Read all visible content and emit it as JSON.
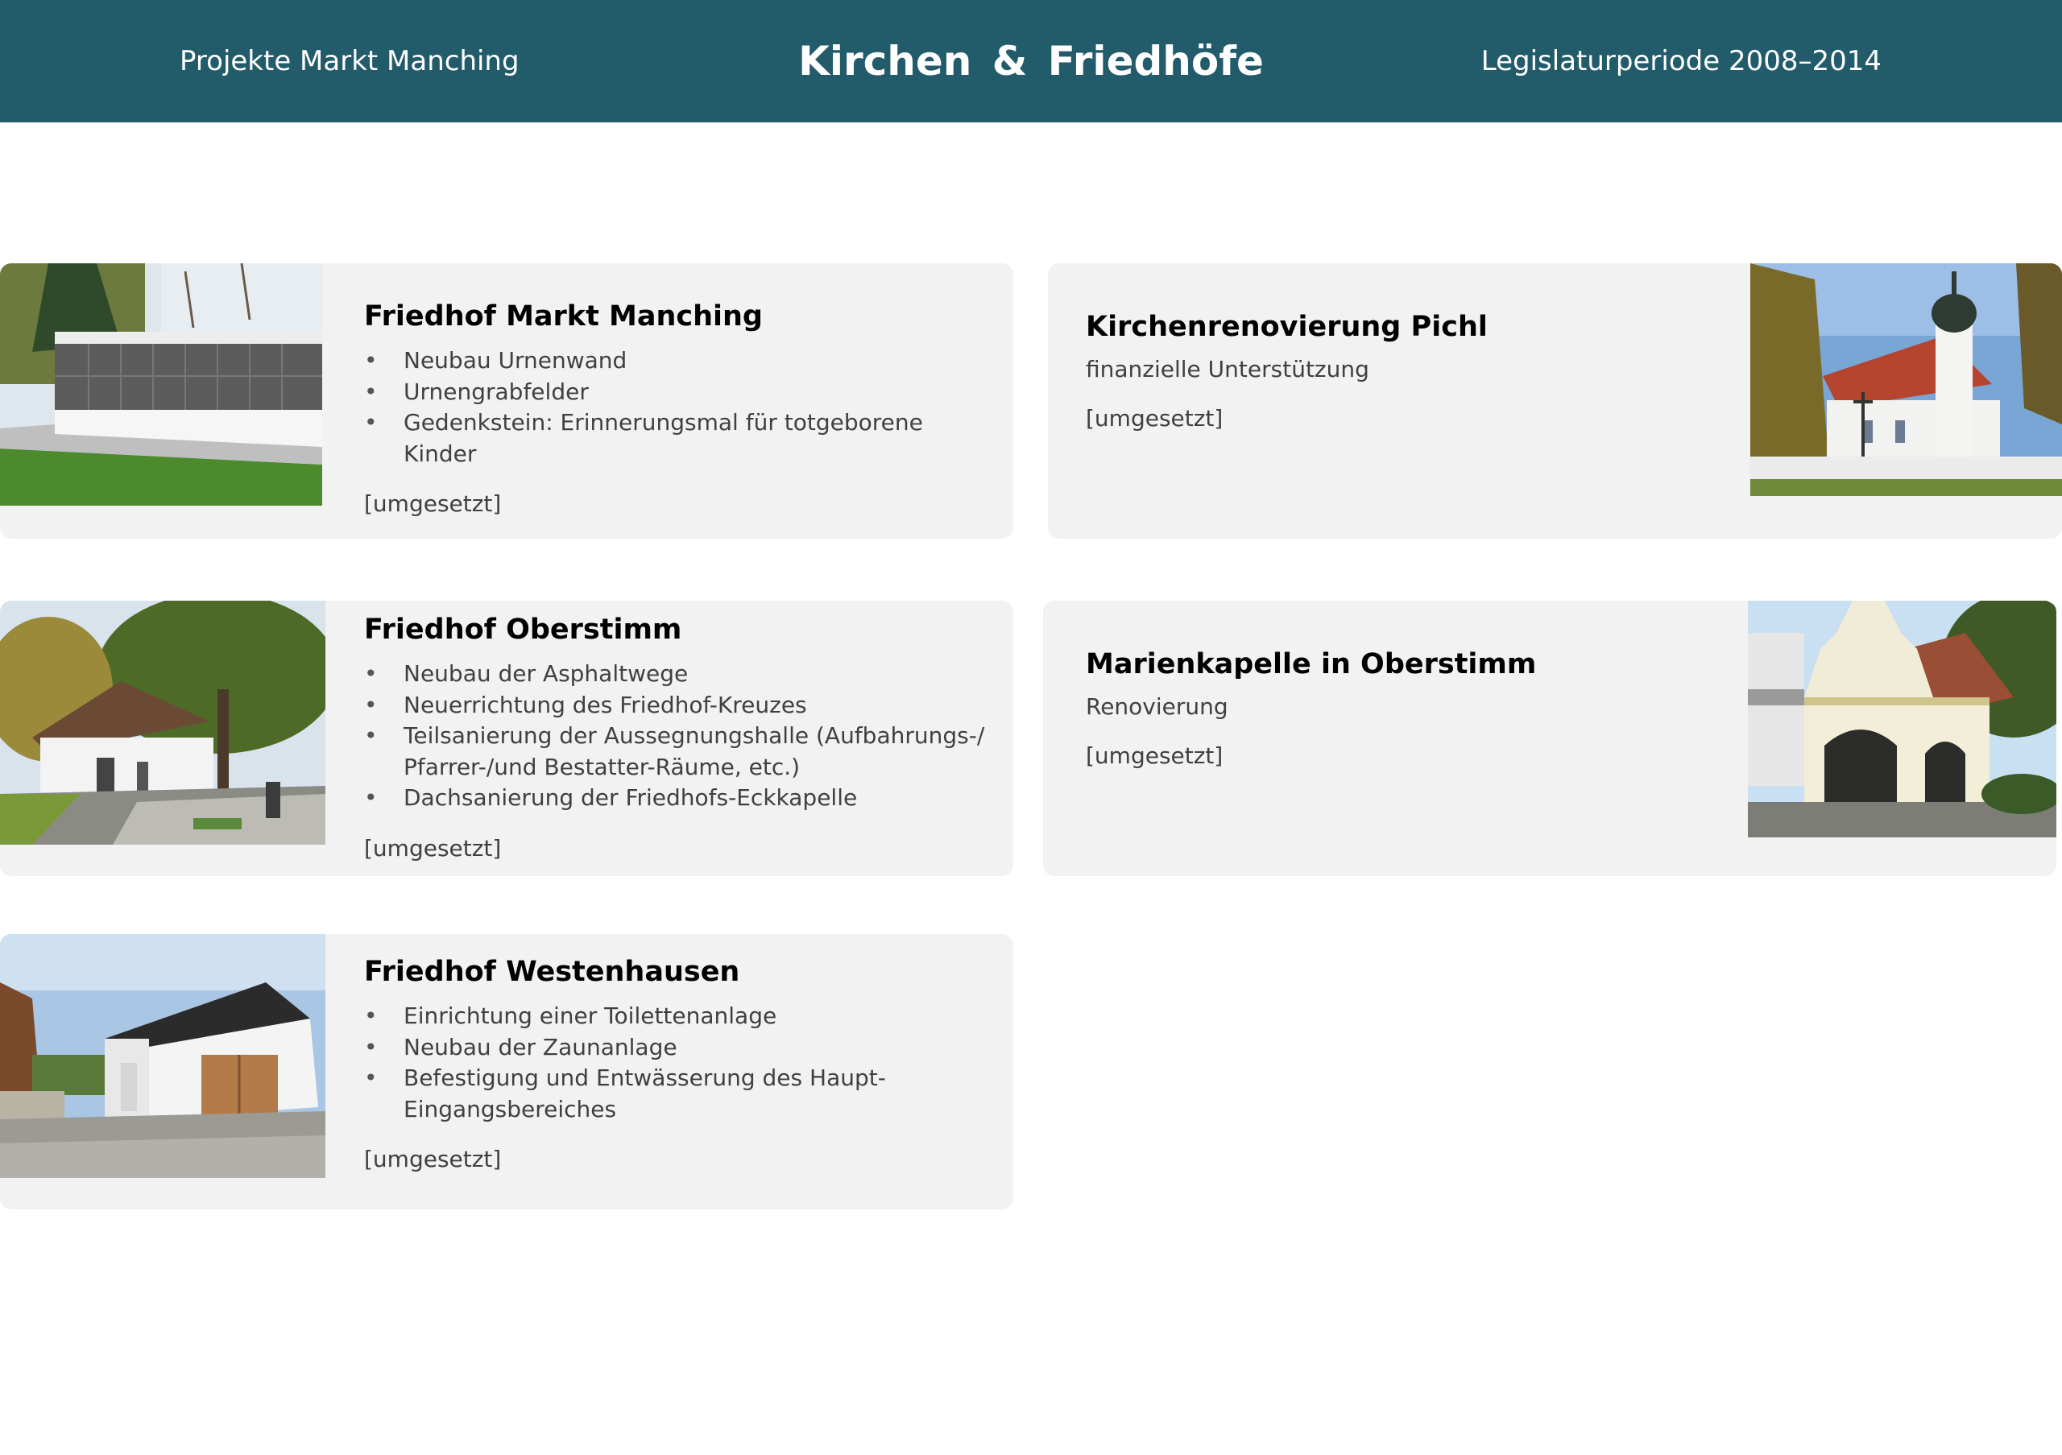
{
  "header": {
    "left": "Projekte Markt Manching",
    "title": "Kirchen  &  Friedhöfe",
    "right": "Legislaturperiode 2008–2014"
  },
  "cards": [
    {
      "title": "Friedhof Markt Manching",
      "items": [
        "Neubau Urnenwand",
        "Urnengrabfelder",
        "Gedenkstein: Erinnerungsmal für totgeborene Kinder"
      ],
      "status": "[umgesetzt]"
    },
    {
      "title": "Kirchenrenovierung Pichl",
      "subtitle": "finanzielle Unterstützung",
      "status": "[umgesetzt]"
    },
    {
      "title": "Friedhof Oberstimm",
      "items": [
        "Neubau der Asphaltwege",
        "Neuerrichtung des Friedhof-Kreuzes",
        "Teilsanierung der Aussegnungshalle (Aufbahrungs-/ Pfarrer-/und Bestatter-Räume, etc.)",
        "Dachsanierung der Friedhofs-Eckkapelle"
      ],
      "status": "[umgesetzt]"
    },
    {
      "title": "Marienkapelle in Oberstimm",
      "subtitle": "Renovierung",
      "status": "[umgesetzt]"
    },
    {
      "title": "Friedhof Westenhausen",
      "items": [
        "Einrichtung einer Toilettenanlage",
        "Neubau der Zaunanlage",
        "Befestigung und Entwässerung des Haupt-Eingangsbereiches"
      ],
      "status": "[umgesetzt]"
    }
  ],
  "colors": {
    "header": "#225b6a",
    "card": "#f2f2f2"
  }
}
